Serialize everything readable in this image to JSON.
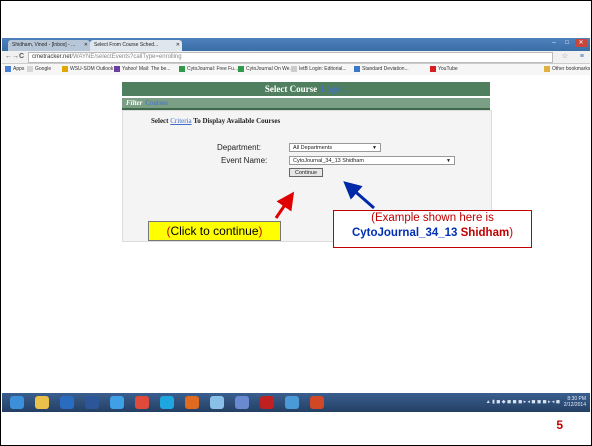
{
  "browser": {
    "tabs": [
      {
        "label": "Shidham, Vinod - [Inbox] - ..."
      },
      {
        "label": "Select From Course Sched..."
      }
    ],
    "url": {
      "host": "cmetracker.net",
      "path": "/WAYNE/selectEvents?callType=enrolling"
    },
    "bookmarks": [
      {
        "label": "Apps",
        "color": "#4a7fd6"
      },
      {
        "label": "Google",
        "color": "#d6d6d6"
      },
      {
        "label": "WSU-SOM Outlook ...",
        "color": "#e0a800"
      },
      {
        "label": "Yahoo! Mail: The be...",
        "color": "#6b3fa0"
      },
      {
        "label": "CytoJournal: Free Fu...",
        "color": "#2e9a4a"
      },
      {
        "label": "CytoJournal On We...",
        "color": "#2e9a4a"
      },
      {
        "label": "IetB Login: Editorial...",
        "color": "#cccccc"
      },
      {
        "label": "Standard Deviation...",
        "color": "#3a78c9"
      },
      {
        "label": "YouTube",
        "color": "#d62020"
      },
      {
        "label": "Other bookmarks",
        "color": "#e0b040"
      }
    ]
  },
  "page": {
    "header_title": "Select Course",
    "header_link": "Logout",
    "filter_label": "Filter",
    "filter_link": "Courses",
    "instruction_prefix": "Select",
    "instruction_link": "Criteria",
    "instruction_suffix": "To Display Available Courses",
    "department_label": "Department:",
    "department_value": "All Departments",
    "event_label": "Event Name:",
    "event_value": "CytoJournal_34_13 Shidham",
    "continue_label": "Continue"
  },
  "taskbar": {
    "icons": [
      {
        "name": "windows-start-icon",
        "color": "#3c8fd8"
      },
      {
        "name": "explorer-icon",
        "color": "#e8c04a"
      },
      {
        "name": "outlook-icon",
        "color": "#2a6cc0"
      },
      {
        "name": "word-icon",
        "color": "#2b579a"
      },
      {
        "name": "ie-icon",
        "color": "#3fa0e8"
      },
      {
        "name": "chrome-icon",
        "color": "#e04a3a"
      },
      {
        "name": "skype-icon",
        "color": "#1ea6e0"
      },
      {
        "name": "media-icon",
        "color": "#e06a20"
      },
      {
        "name": "paint-icon",
        "color": "#8ac0e8"
      },
      {
        "name": "app-icon",
        "color": "#6a8ad0"
      },
      {
        "name": "acrobat-icon",
        "color": "#c02020"
      },
      {
        "name": "snipping-icon",
        "color": "#4a9ad8"
      },
      {
        "name": "powerpoint-icon",
        "color": "#d24726"
      }
    ],
    "clock_time": "8:30 PM",
    "clock_date": "2/12/2014"
  },
  "annotations": {
    "click_open": "(",
    "click_text": "Click to continue",
    "click_close": ")",
    "example_line1": "(Example shown here is",
    "example_event": "CytoJournal_34_13",
    "example_name": "Shidham",
    "example_close": ")"
  },
  "slide_number": "5",
  "colors": {
    "header_green": "#507f5f",
    "annotation_red": "#c00000",
    "annotation_blue": "#002fb3",
    "callout_yellow": "#ffff00"
  }
}
